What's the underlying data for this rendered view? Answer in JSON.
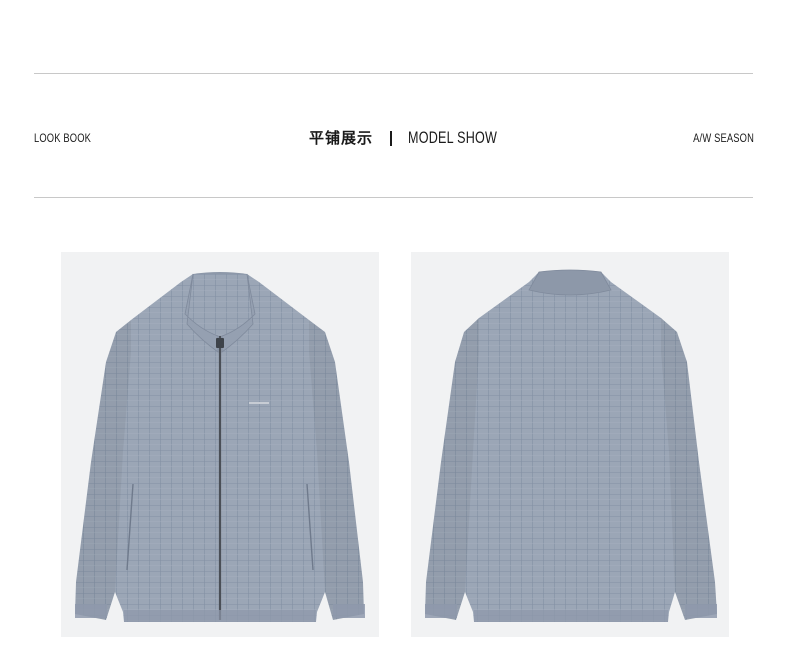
{
  "header": {
    "left_label": "LOOK BOOK",
    "center_cn": "平铺展示",
    "center_en": "MODEL SHOW",
    "right_label": "A/W SEASON"
  },
  "products": [
    {
      "view": "front",
      "color": "#9ba6b6"
    },
    {
      "view": "back",
      "color": "#9ba6b6"
    }
  ],
  "colors": {
    "background": "#ffffff",
    "rule": "#c8c8c8",
    "photo_bg": "#f1f2f3",
    "jacket": "#9ba6b6"
  }
}
